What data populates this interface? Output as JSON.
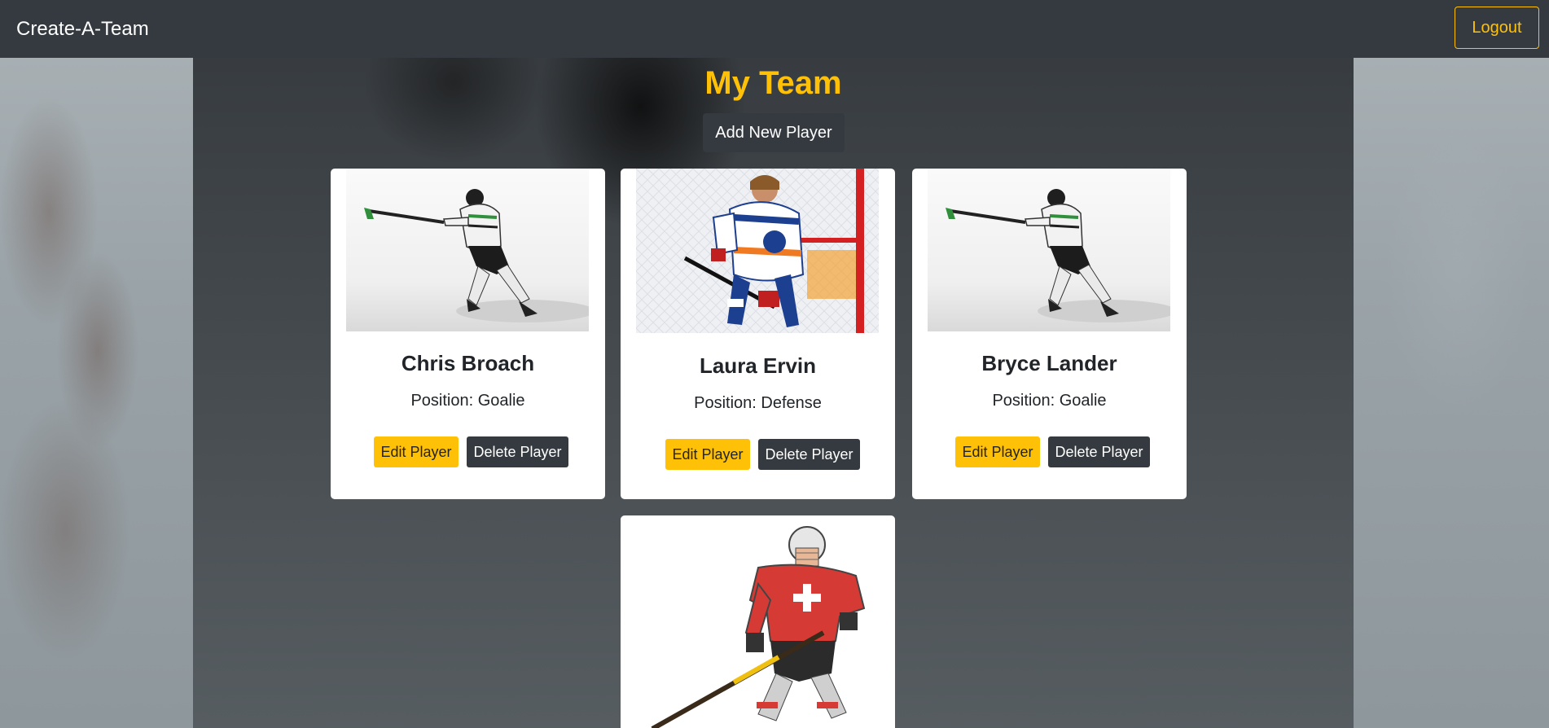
{
  "navbar": {
    "brand": "Create-A-Team",
    "logout_label": "Logout"
  },
  "main": {
    "title": "My Team",
    "add_player_label": "Add New Player"
  },
  "players": [
    {
      "name": "Chris Broach",
      "position": "Position: Goalie",
      "edit_label": "Edit Player",
      "delete_label": "Delete Player"
    },
    {
      "name": "Laura Ervin",
      "position": "Position: Defense",
      "edit_label": "Edit Player",
      "delete_label": "Delete Player"
    },
    {
      "name": "Bryce Lander",
      "position": "Position: Goalie",
      "edit_label": "Edit Player",
      "delete_label": "Delete Player"
    },
    {
      "name": "",
      "position": "",
      "edit_label": "",
      "delete_label": ""
    }
  ],
  "colors": {
    "navbar_bg": "#343a40",
    "accent_yellow": "#ffc107",
    "dark_button": "#343a40",
    "card_bg": "#ffffff"
  },
  "icons": {
    "player_photo_1": "hockey-player-shooting-photo",
    "player_photo_2": "hockey-player-edmonton-photo",
    "player_photo_3": "hockey-player-shooting-photo",
    "player_photo_4": "hockey-player-red-jersey-illustration"
  }
}
